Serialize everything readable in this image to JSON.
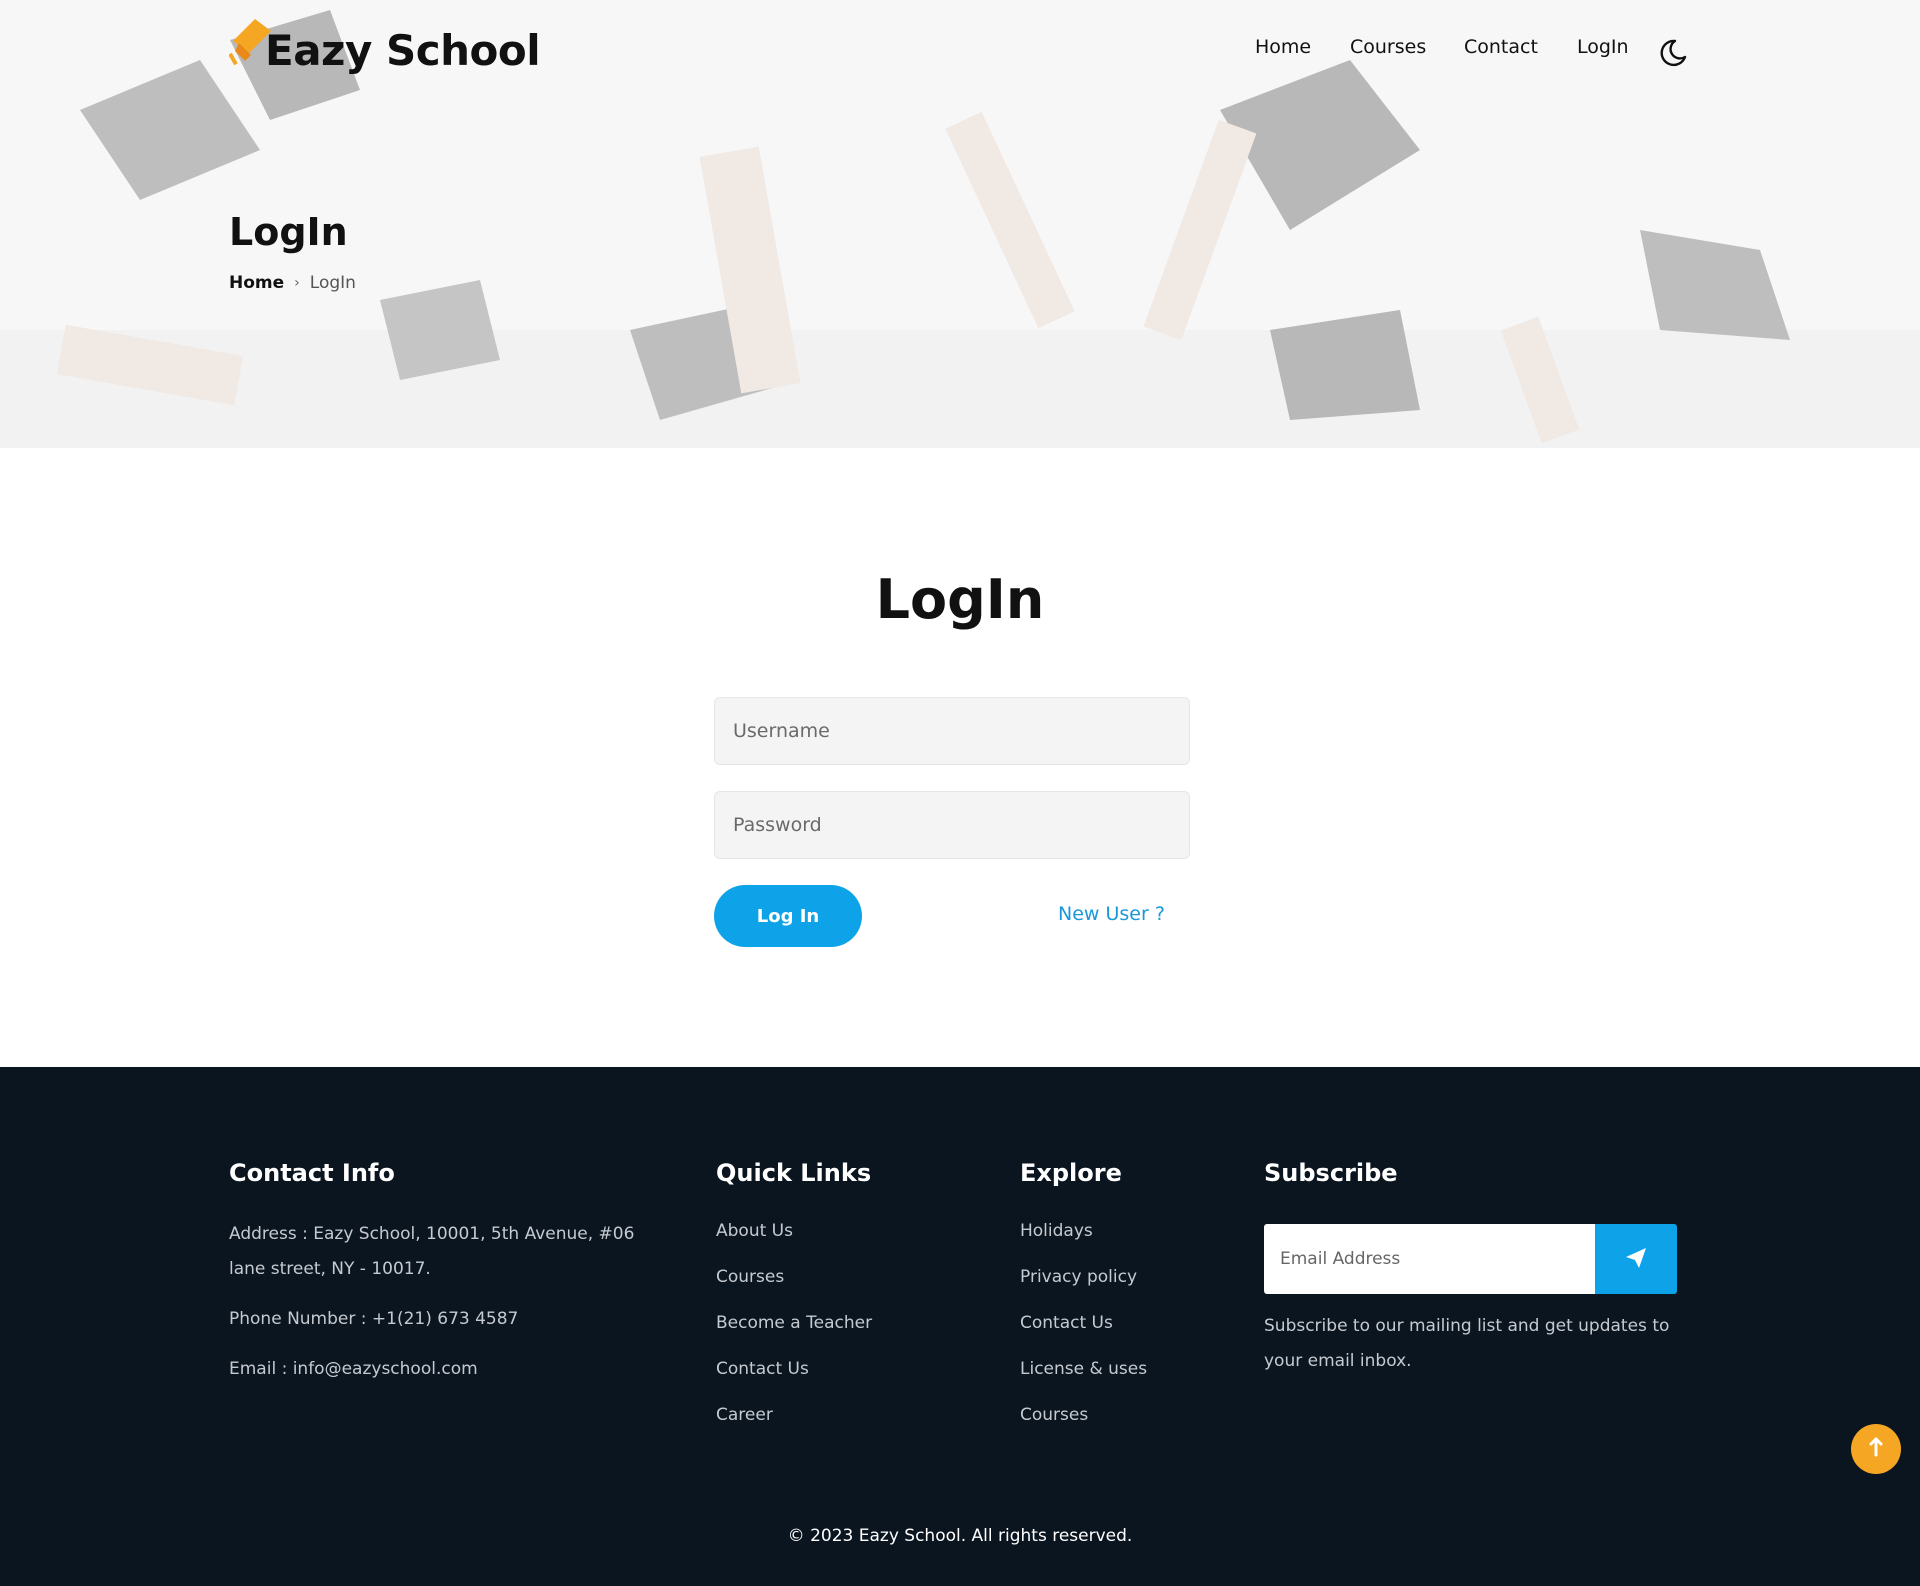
{
  "brand": {
    "name": "Eazy School",
    "icon": "graduation-cap-icon"
  },
  "nav": {
    "items": [
      {
        "label": "Home"
      },
      {
        "label": "Courses"
      },
      {
        "label": "Contact"
      },
      {
        "label": "LogIn"
      }
    ],
    "theme_icon": "moon-icon"
  },
  "hero": {
    "title": "LogIn",
    "breadcrumb": {
      "home": "Home",
      "separator": "›",
      "current": "LogIn"
    }
  },
  "login": {
    "heading": "LogIn",
    "username_placeholder": "Username",
    "password_placeholder": "Password",
    "submit_label": "Log In",
    "new_user_label": "New User ?"
  },
  "footer": {
    "contact": {
      "heading": "Contact Info",
      "address": "Address : Eazy School, 10001, 5th Avenue, #06 lane street, NY - 10017.",
      "phone": "Phone Number : +1(21) 673 4587",
      "email": "Email : info@eazyschool.com"
    },
    "quick_links": {
      "heading": "Quick Links",
      "items": [
        "About Us",
        "Courses",
        "Become a Teacher",
        "Contact Us",
        "Career"
      ]
    },
    "explore": {
      "heading": "Explore",
      "items": [
        "Holidays",
        "Privacy policy",
        "Contact Us",
        "License & uses",
        "Courses"
      ]
    },
    "subscribe": {
      "heading": "Subscribe",
      "placeholder": "Email Address",
      "button_icon": "paper-plane-icon",
      "text": "Subscribe to our mailing list and get updates to your email inbox."
    },
    "copyright": "© 2023 Eazy School. All rights reserved."
  },
  "colors": {
    "accent": "#0ea3e8",
    "orange": "#f5a623",
    "footer_bg": "#0b1520"
  },
  "scroll_top_icon": "arrow-up-icon"
}
